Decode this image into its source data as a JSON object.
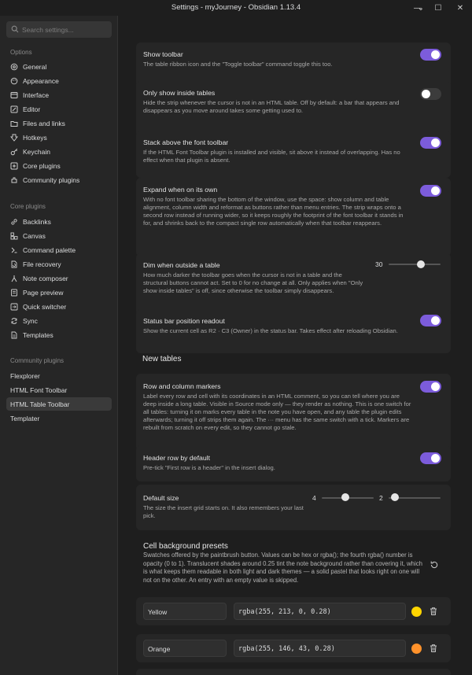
{
  "window": {
    "title": "Settings - myJourney - Obsidian 1.13.4",
    "minimize_glyph": "—",
    "maximize_glyph": "☐",
    "close_glyph": "✕",
    "menu_glyph": "⌄"
  },
  "sidebar": {
    "search_placeholder": "Search settings...",
    "options_header": "Options",
    "options": [
      {
        "label": "General",
        "icon": "general-icon"
      },
      {
        "label": "Appearance",
        "icon": "appearance-icon"
      },
      {
        "label": "Interface",
        "icon": "interface-icon"
      },
      {
        "label": "Editor",
        "icon": "editor-icon"
      },
      {
        "label": "Files and links",
        "icon": "files-icon"
      },
      {
        "label": "Hotkeys",
        "icon": "hotkeys-icon"
      },
      {
        "label": "Keychain",
        "icon": "keychain-icon"
      },
      {
        "label": "Core plugins",
        "icon": "core-plugins-icon"
      },
      {
        "label": "Community plugins",
        "icon": "community-plugins-icon"
      }
    ],
    "core_header": "Core plugins",
    "core": [
      {
        "label": "Backlinks",
        "icon": "backlinks-icon"
      },
      {
        "label": "Canvas",
        "icon": "canvas-icon"
      },
      {
        "label": "Command palette",
        "icon": "command-palette-icon"
      },
      {
        "label": "File recovery",
        "icon": "file-recovery-icon"
      },
      {
        "label": "Note composer",
        "icon": "note-composer-icon"
      },
      {
        "label": "Page preview",
        "icon": "page-preview-icon"
      },
      {
        "label": "Quick switcher",
        "icon": "quick-switcher-icon"
      },
      {
        "label": "Sync",
        "icon": "sync-icon"
      },
      {
        "label": "Templates",
        "icon": "templates-icon"
      }
    ],
    "community_header": "Community plugins",
    "community": [
      {
        "label": "Flexplorer"
      },
      {
        "label": "HTML Font Toolbar"
      },
      {
        "label": "HTML Table Toolbar",
        "active": true
      },
      {
        "label": "Templater"
      }
    ]
  },
  "settings": {
    "show_toolbar": {
      "name": "Show toolbar",
      "desc": "The table ribbon icon and the \"Toggle toolbar\" command toggle this too.",
      "enabled": true
    },
    "only_inside": {
      "name": "Only show inside tables",
      "desc": "Hide the strip whenever the cursor is not in an HTML table. Off by default: a bar that appears and disappears as you move around takes some getting used to.",
      "enabled": false
    },
    "stack_above": {
      "name": "Stack above the font toolbar",
      "desc": "If the HTML Font Toolbar plugin is installed and visible, sit above it instead of overlapping. Has no effect when that plugin is absent.",
      "enabled": true
    },
    "expand": {
      "name": "Expand when on its own",
      "desc": "With no font toolbar sharing the bottom of the window, use the space: show column and table alignment, column width and reformat as buttons rather than menu entries. The strip wraps onto a second row instead of running wider, so it keeps roughly the footprint of the font toolbar it stands in for, and shrinks back to the compact single row automatically when that toolbar reappears.",
      "enabled": true
    },
    "dim": {
      "name": "Dim when outside a table",
      "desc": "How much darker the toolbar goes when the cursor is not in a table and the structural buttons cannot act. Set to 0 for no change at all. Only applies when \"Only show inside tables\" is off, since otherwise the toolbar simply disappears.",
      "value": "30",
      "fraction": 0.62
    },
    "status": {
      "name": "Status bar position readout",
      "desc": "Show the current cell as R2 · C3 (Owner) in the status bar. Takes effect after reloading Obsidian.",
      "enabled": true
    },
    "new_tables_heading": "New tables",
    "markers": {
      "name": "Row and column markers",
      "desc": "Label every row and cell with its coordinates in an HTML comment, so you can tell where you are deep inside a long table. Visible in Source mode only — they render as nothing. This is one switch for all tables: turning it on marks every table in the note you have open, and any table the plugin edits afterwards; turning it off strips them again. The ··· menu has the same switch with a tick. Markers are rebuilt from scratch on every edit, so they cannot go stale.",
      "enabled": true
    },
    "header_row": {
      "name": "Header row by default",
      "desc": "Pre-tick \"First row is a header\" in the insert dialog.",
      "enabled": true
    },
    "default_size": {
      "name": "Default size",
      "desc": "The size the insert grid starts on. It also remembers your last pick.",
      "rows": "4",
      "rows_fraction": 0.45,
      "cols": "2",
      "cols_fraction": 0.12
    },
    "presets_heading": "Cell background presets",
    "presets_desc": "Swatches offered by the paintbrush button. Values can be hex or rgba(); the fourth rgba() number is opacity (0 to 1). Translucent shades around 0.25 tint the note background rather than covering it, which is what keeps them readable in both light and dark themes — a solid pastel that looks right on one will not on the other. An entry with an empty value is skipped.",
    "presets": [
      {
        "name": "Yellow",
        "value": "rgba(255, 213, 0, 0.28)",
        "color": "#ffd500"
      },
      {
        "name": "Orange",
        "value": "rgba(255, 146, 43, 0.28)",
        "color": "#ff922b"
      }
    ]
  },
  "colors": {
    "accent": "#7c5cdb",
    "card": "#262626",
    "background": "#1e1e1e"
  }
}
